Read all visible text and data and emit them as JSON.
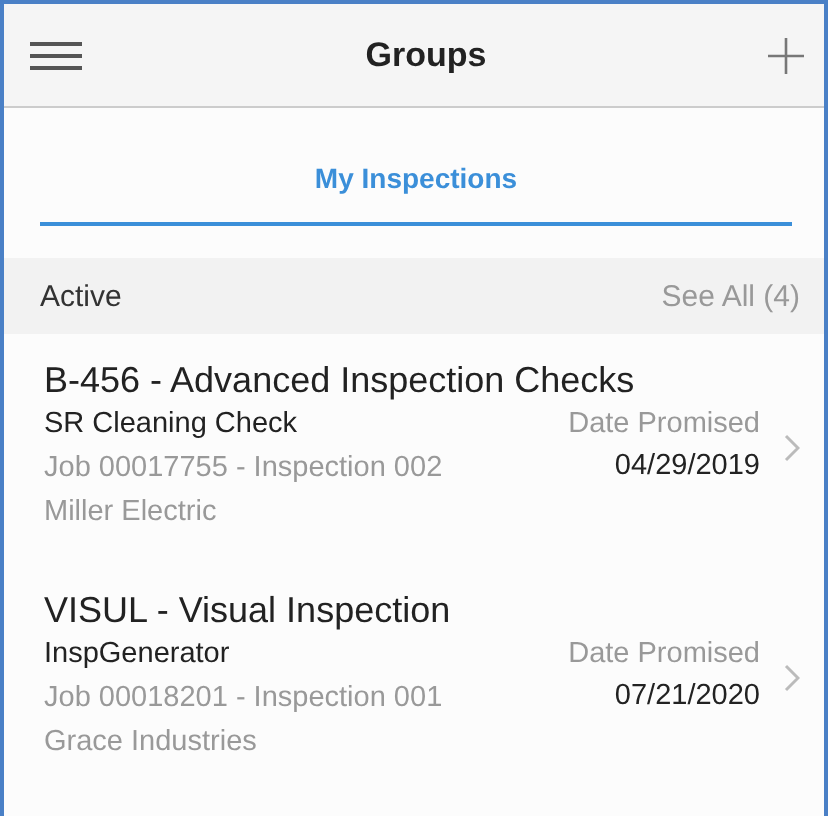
{
  "header": {
    "title": "Groups"
  },
  "tabs": [
    {
      "label": "My Inspections",
      "selected": true
    }
  ],
  "section": {
    "title": "Active",
    "action": "See All (4)"
  },
  "items": [
    {
      "title": "B-456 - Advanced Inspection Checks",
      "subtitle": "SR Cleaning Check",
      "job": "Job 00017755 - Inspection 002",
      "company": "Miller Electric",
      "date_label": "Date Promised",
      "date": "04/29/2019"
    },
    {
      "title": "VISUL - Visual Inspection",
      "subtitle": "InspGenerator",
      "job": "Job 00018201 - Inspection 001",
      "company": "Grace Industries",
      "date_label": "Date Promised",
      "date": "07/21/2020"
    }
  ]
}
